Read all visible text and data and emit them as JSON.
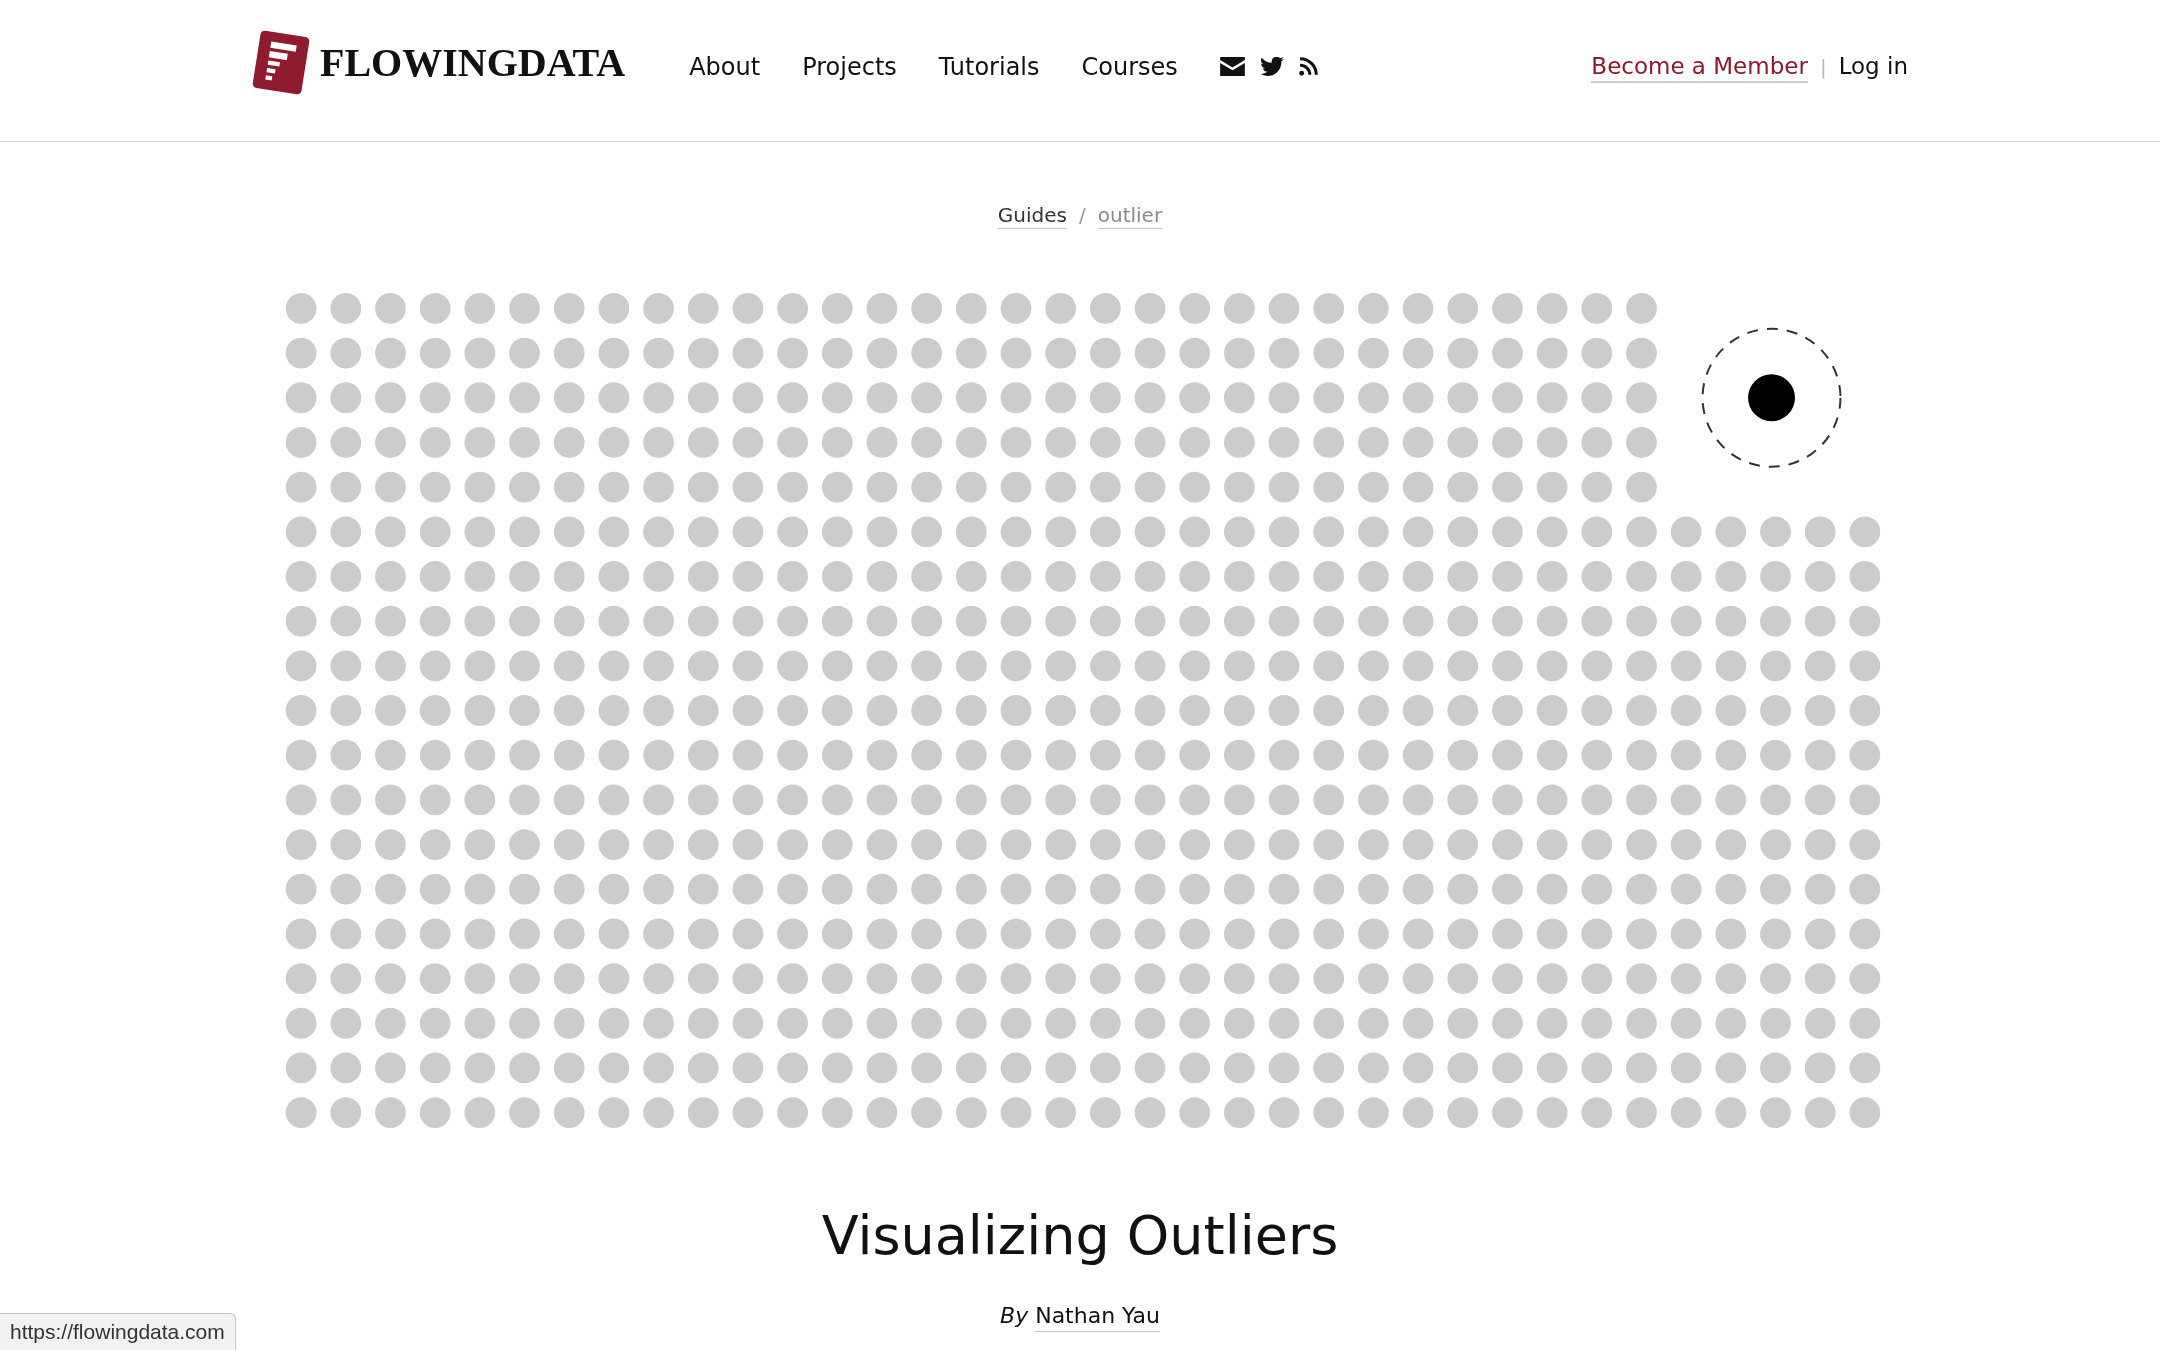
{
  "header": {
    "logo": {
      "wordmark": "FLOWINGDATA"
    },
    "nav": [
      {
        "label": "About"
      },
      {
        "label": "Projects"
      },
      {
        "label": "Tutorials"
      },
      {
        "label": "Courses"
      }
    ],
    "account": {
      "member_link": "Become a Member",
      "separator": "|",
      "login_link": "Log in"
    }
  },
  "breadcrumb": {
    "items": [
      {
        "label": "Guides",
        "current": false
      },
      {
        "label": "outlier",
        "current": true
      }
    ],
    "separator": "/"
  },
  "article": {
    "title": "Visualizing Outliers",
    "byline": {
      "prefix": "By",
      "author": "Nathan Yau"
    }
  },
  "status_bar": {
    "url": "https://flowingdata.com"
  }
}
